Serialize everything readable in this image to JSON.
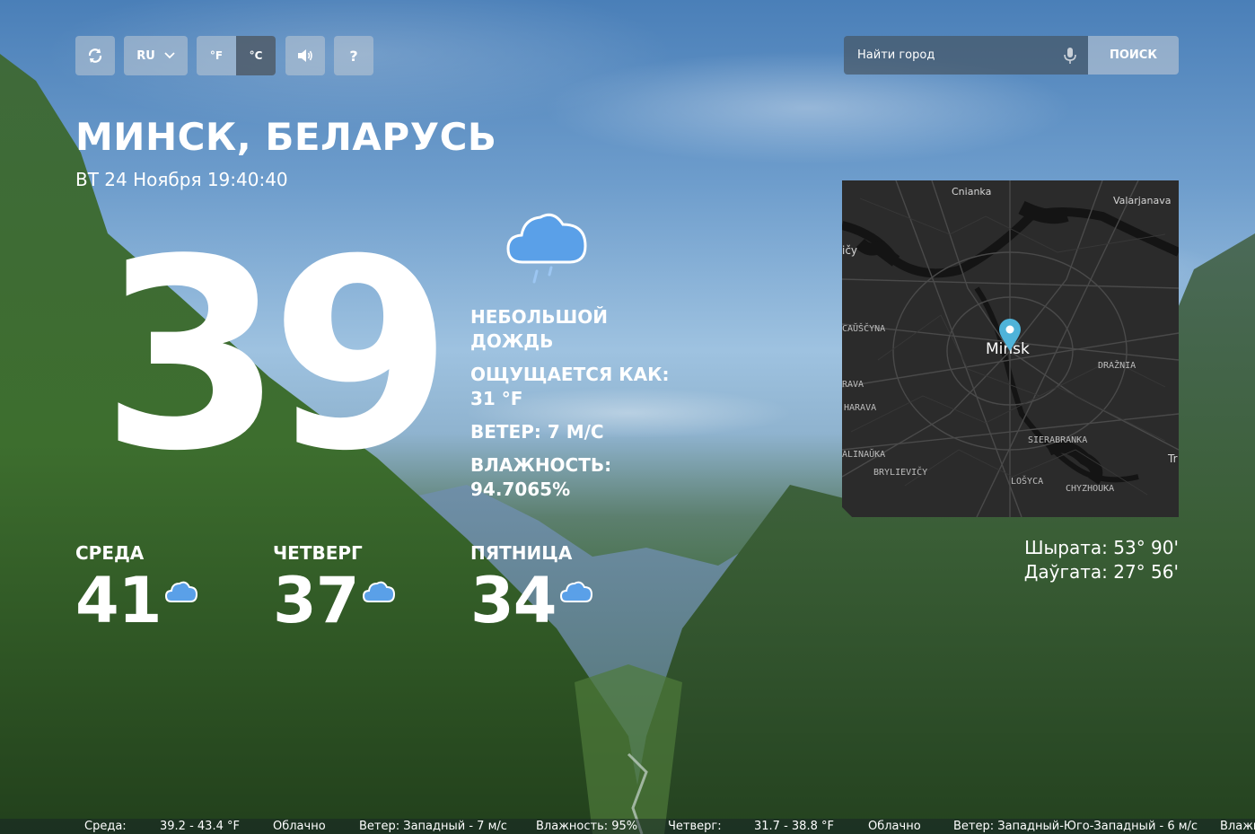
{
  "controls": {
    "language": "RU",
    "unit_f": "°F",
    "unit_c": "°C",
    "help": "?"
  },
  "search": {
    "placeholder": "Найти город",
    "button": "ПОИСК"
  },
  "location": {
    "city": "МИНСК, БЕЛАРУСЬ",
    "datetime": "ВТ 24 Ноября 19:40:40"
  },
  "current": {
    "temperature": "39",
    "icon": "rain-cloud-icon",
    "description": "НЕБОЛЬШОЙ ДОЖДЬ",
    "feels_like": "ОЩУЩАЕТСЯ КАК: 31 °F",
    "wind": "ВЕТЕР: 7 М/С",
    "humidity": "ВЛАЖНОСТЬ: 94.7065%"
  },
  "forecast": [
    {
      "day": "СРЕДА",
      "temp": "41",
      "icon": "cloud-icon"
    },
    {
      "day": "ЧЕТВЕРГ",
      "temp": "37",
      "icon": "cloud-icon"
    },
    {
      "day": "ПЯТНИЦА",
      "temp": "34",
      "icon": "cloud-icon"
    }
  ],
  "map": {
    "labels": {
      "cnianka": "Cnianka",
      "valarjanava": "Valarjanava",
      "icy": "ičy",
      "causcyna": "CAŬŠČYNA",
      "minsk": "Minsk",
      "draznia": "DRAŽNIA",
      "rava": "RAVA",
      "harava": "HARAVA",
      "sierabranka": "SIERABRANKA",
      "alinauka": "ALINAŬKA",
      "brylievicy": "BRYLIEVIČY",
      "tr": "Tr",
      "loscyca": "LOŠYCA",
      "chyzhouka": "CHYZHOUKA"
    }
  },
  "coordinates": {
    "latitude": "Шырата: 53° 90'",
    "longitude": "Даўгата: 27° 56'"
  },
  "ticker": {
    "items": [
      "Среда:",
      "39.2 - 43.4 °F",
      "Облачно",
      "Ветер: Западный - 7 м/с",
      "Влажность: 95%",
      "Четверг:",
      "31.7 - 38.8 °F",
      "Облачно",
      "Ветер: Западный-Юго-Западный - 6 м/с",
      "Влажн"
    ]
  },
  "colors": {
    "icon_blue": "#5aa0e8",
    "map_bg": "#2b2b2b",
    "marker": "#4fb3d9"
  }
}
